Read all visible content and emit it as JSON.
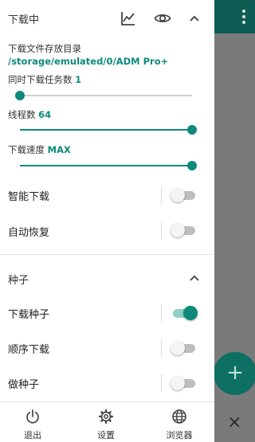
{
  "header": {
    "title": "下载中"
  },
  "settings": {
    "dir_label": "下载文件存放目录",
    "dir_path": "/storage/emulated/0/ADM Pro+",
    "tasks_label": "同时下载任务数",
    "tasks_value": "1",
    "tasks_level": 0,
    "threads_label": "线程数",
    "threads_value": "64",
    "threads_level": 1,
    "speed_label": "下载速度",
    "speed_value": "MAX",
    "speed_level": 1
  },
  "toggles": [
    {
      "label": "智能下载",
      "on": false
    },
    {
      "label": "自动恢复",
      "on": false
    }
  ],
  "torrent": {
    "title": "种子",
    "toggles": [
      {
        "label": "下载种子",
        "on": true
      },
      {
        "label": "顺序下载",
        "on": false
      },
      {
        "label": "做种子",
        "on": false
      }
    ]
  },
  "bottom_nav": [
    {
      "label": "退出",
      "icon": "power-icon"
    },
    {
      "label": "设置",
      "icon": "gear-icon"
    },
    {
      "label": "浏览器",
      "icon": "globe-icon"
    }
  ],
  "background": {
    "fab_icon": "+",
    "close_icon": "×"
  },
  "colors": {
    "accent": "#0d8a7c",
    "topbar": "#0d5d55",
    "fab": "#0e6f63"
  }
}
